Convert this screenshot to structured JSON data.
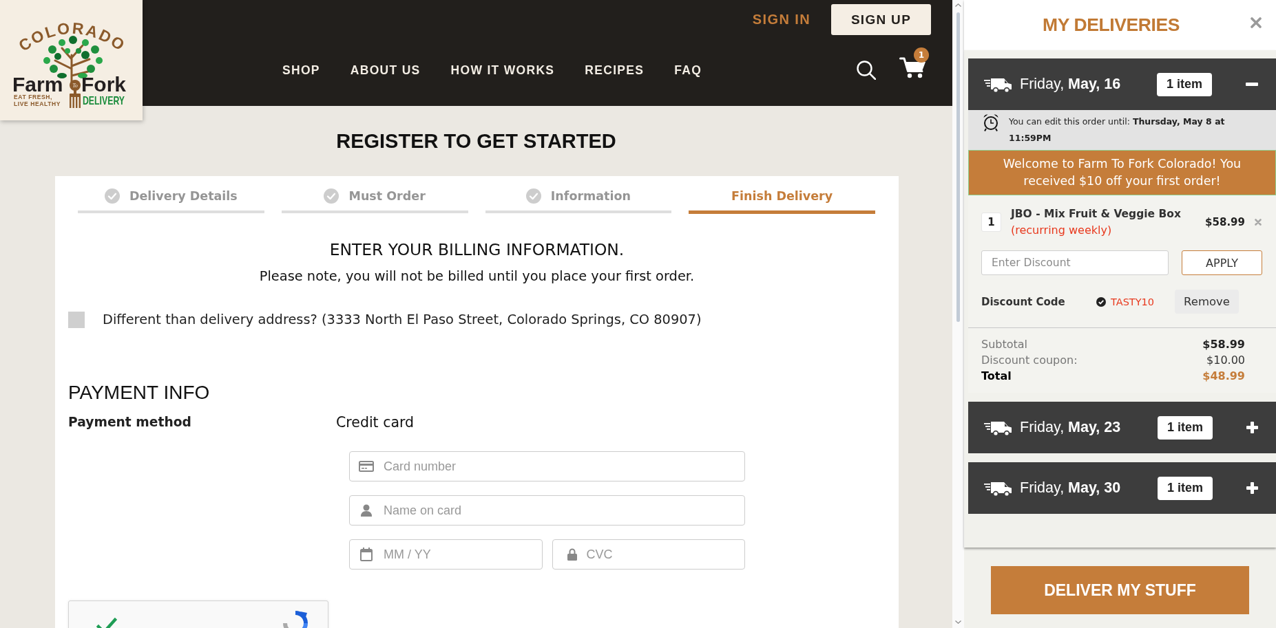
{
  "header": {
    "logo": {
      "arc": "COLORADO",
      "word_left": "Farm",
      "fork_label": "To",
      "word_right": "Fork",
      "tagline": [
        "EAT FRESH,",
        "LIVE HEALTHY"
      ],
      "subtitle": "DELIVERY"
    },
    "sign_in": "SIGN IN",
    "sign_up": "SIGN UP",
    "nav": [
      "SHOP",
      "ABOUT US",
      "HOW IT WORKS",
      "RECIPES",
      "FAQ"
    ],
    "cart_count": "1"
  },
  "page_title": "REGISTER TO GET STARTED",
  "steps": [
    {
      "label": "Delivery Details",
      "done": true,
      "selected": false
    },
    {
      "label": "Must Order",
      "done": true,
      "selected": false
    },
    {
      "label": "Information",
      "done": true,
      "selected": false
    },
    {
      "label": "Finish Delivery",
      "done": false,
      "selected": true
    }
  ],
  "billing": {
    "heading": "ENTER YOUR BILLING INFORMATION.",
    "note": "Please note, you will not be billed until you place your first order.",
    "different_address": {
      "label": "Different than delivery address? (3333 North El Paso Street, Colorado Springs, CO 80907)",
      "checked": false
    }
  },
  "payment": {
    "title": "PAYMENT INFO",
    "method_label": "Payment method",
    "method_value": "Credit card",
    "field_rows": [
      [
        {
          "kind": "card_number",
          "placeholder": "Card number"
        }
      ],
      [
        {
          "kind": "cardholder",
          "placeholder": "Name on card"
        }
      ],
      [
        {
          "kind": "expiry",
          "placeholder": "MM / YY"
        },
        {
          "kind": "cvc",
          "placeholder": "CVC"
        }
      ]
    ],
    "captcha": {
      "checked": true
    }
  },
  "deliveries_panel": {
    "title": "MY DELIVERIES",
    "deliveries": [
      {
        "date": "Friday, **May, 16**",
        "count": "1 item",
        "expanded": true,
        "edit_notice": "You can edit this order until: **Thursday, May 8 at 11:59PM**",
        "promo": "Welcome to Farm To Fork Colorado! You received $10 off your first order!",
        "items": [
          {
            "qty": "1",
            "name": "JBO - Mix Fruit & Veggie Box",
            "note": "(recurring weekly)",
            "price": "$58.99"
          }
        ],
        "discount": {
          "placeholder": "Enter Discount",
          "button": "APPLY",
          "code_label": "Discount Code",
          "code": "TASTY10",
          "remove": "Remove"
        },
        "totals": [
          {
            "kind": "subtotal",
            "label": "Subtotal",
            "value": "$58.99"
          },
          {
            "kind": "discount",
            "label": "Discount coupon:",
            "value": "$10.00"
          },
          {
            "kind": "total",
            "label": "Total",
            "value": "$48.99"
          }
        ]
      },
      {
        "date": "Friday, **May, 23**",
        "count": "1 item",
        "expanded": false
      },
      {
        "date": "Friday, **May, 30**",
        "count": "1 item",
        "expanded": false
      }
    ],
    "button": "DELIVER MY STUFF"
  }
}
